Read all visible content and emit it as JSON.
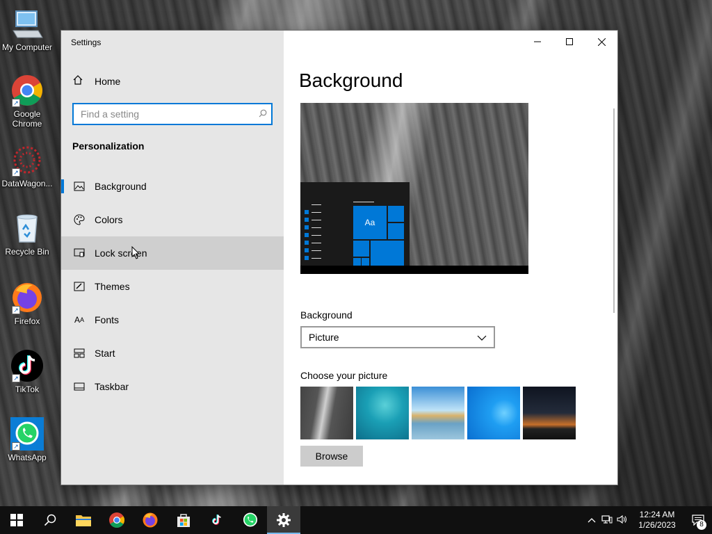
{
  "desktop": {
    "icons": [
      {
        "label": "My Computer",
        "icon": "computer-icon"
      },
      {
        "label": "Google Chrome",
        "icon": "chrome-icon"
      },
      {
        "label": "DataWagon...",
        "icon": "datawagon-icon"
      },
      {
        "label": "Recycle Bin",
        "icon": "recycle-bin-icon"
      },
      {
        "label": "Firefox",
        "icon": "firefox-icon"
      },
      {
        "label": "TikTok",
        "icon": "tiktok-icon"
      },
      {
        "label": "WhatsApp",
        "icon": "whatsapp-icon"
      }
    ]
  },
  "window": {
    "title": "Settings",
    "caption": {
      "minimize": "—",
      "maximize": "☐",
      "close": "✕"
    }
  },
  "sidebar": {
    "home_label": "Home",
    "search_placeholder": "Find a setting",
    "section_title": "Personalization",
    "items": [
      {
        "label": "Background",
        "icon": "picture-icon",
        "state": "active"
      },
      {
        "label": "Colors",
        "icon": "palette-icon",
        "state": ""
      },
      {
        "label": "Lock screen",
        "icon": "lock-screen-icon",
        "state": "hover"
      },
      {
        "label": "Themes",
        "icon": "brush-icon",
        "state": ""
      },
      {
        "label": "Fonts",
        "icon": "font-icon",
        "state": ""
      },
      {
        "label": "Start",
        "icon": "start-grid-icon",
        "state": ""
      },
      {
        "label": "Taskbar",
        "icon": "taskbar-icon",
        "state": ""
      }
    ]
  },
  "content": {
    "page_title": "Background",
    "preview_tile_text": "Aa",
    "background_label": "Background",
    "background_value": "Picture",
    "choose_picture_label": "Choose your picture",
    "browse_label": "Browse"
  },
  "taskbar": {
    "clock_time": "12:24 AM",
    "clock_date": "1/26/2023",
    "notification_count": "8",
    "accent": "#0078d7"
  }
}
